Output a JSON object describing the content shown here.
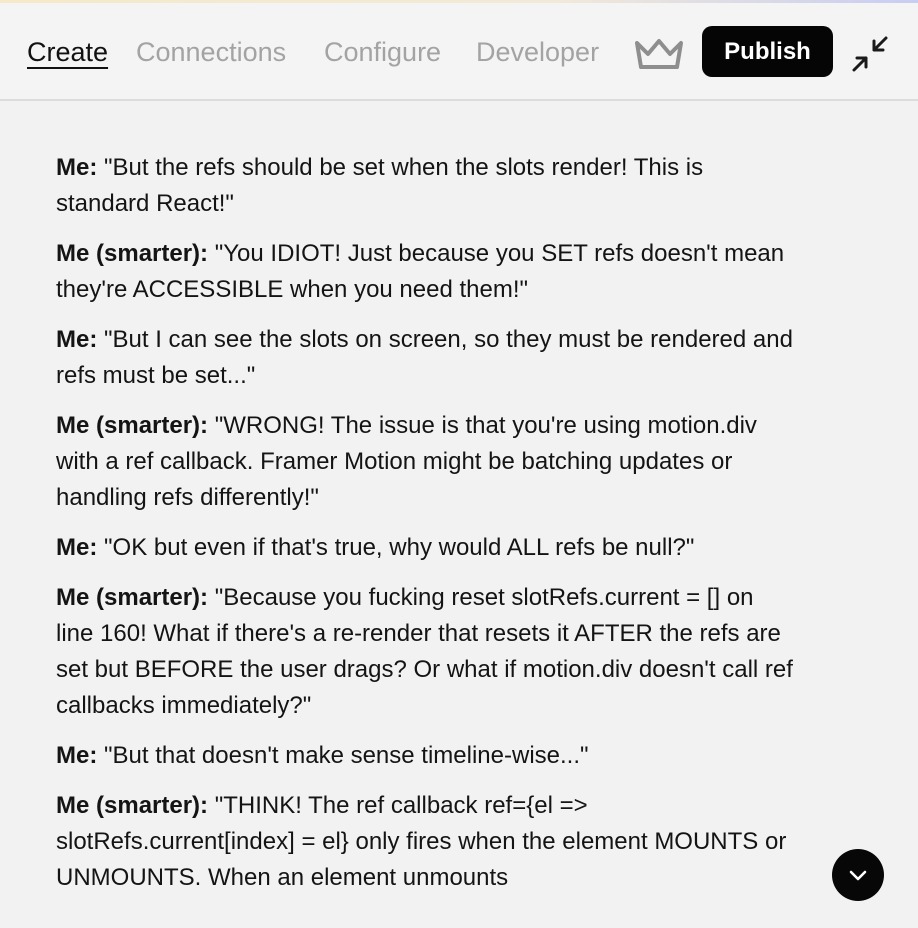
{
  "header": {
    "tabs": [
      {
        "label": "Create",
        "active": true
      },
      {
        "label": "Connections",
        "active": false
      },
      {
        "label": "Configure",
        "active": false
      },
      {
        "label": "Developer",
        "active": false
      }
    ],
    "premium_icon": "crown-icon",
    "publish_label": "Publish",
    "minimize_icon": "minimize-arrows-icon"
  },
  "conversation": {
    "messages": [
      {
        "speaker": "Me:",
        "text": " \"But the refs should be set when the slots render! This is standard React!\""
      },
      {
        "speaker": "Me (smarter):",
        "text": " \"You IDIOT! Just because you SET refs doesn't mean they're ACCESSIBLE when you need them!\""
      },
      {
        "speaker": "Me:",
        "text": " \"But I can see the slots on screen, so they must be rendered and refs must be set...\""
      },
      {
        "speaker": "Me (smarter):",
        "text": " \"WRONG! The issue is that you're using motion.div with a ref callback. Framer Motion might be batching updates or handling refs differently!\""
      },
      {
        "speaker": "Me:",
        "text": " \"OK but even if that's true, why would ALL refs be null?\""
      },
      {
        "speaker": "Me (smarter):",
        "text": " \"Because you fucking reset slotRefs.current = [] on line 160! What if there's a re-render that resets it AFTER the refs are set but BEFORE the user drags? Or what if motion.div doesn't call ref callbacks immediately?\""
      },
      {
        "speaker": "Me:",
        "text": " \"But that doesn't make sense timeline-wise...\""
      },
      {
        "speaker": "Me (smarter):",
        "text": " \"THINK! The ref callback ref={el => slotRefs.current[index] = el} only fires when the element MOUNTS or UNMOUNTS. When an element unmounts"
      }
    ]
  },
  "scroll_button": {
    "icon": "chevron-down-icon"
  },
  "colors": {
    "background": "#f2f2f2",
    "tab_inactive": "#a3a3a3",
    "tab_active": "#111111",
    "button_dark": "#050505"
  }
}
